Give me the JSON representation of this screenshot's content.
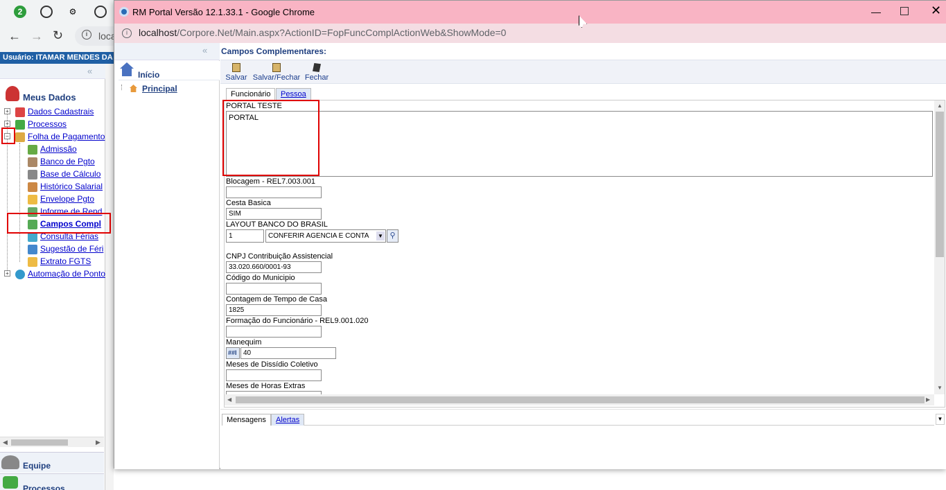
{
  "background_browser": {
    "badge": "2",
    "address_partial": "loca",
    "user_label": "Usuário: ITAMAR MENDES DA"
  },
  "bg_sidebar": {
    "section_title": "Meus Dados",
    "items": [
      {
        "label": "Dados Cadastrais",
        "icon": "person-icon"
      },
      {
        "label": "Processos",
        "icon": "processes-icon"
      },
      {
        "label": "Folha de Pagamento",
        "icon": "payroll-icon"
      },
      {
        "label": "Admissão",
        "icon": "person-icon"
      },
      {
        "label": "Banco de Pgto",
        "icon": "bank-icon"
      },
      {
        "label": "Base de Cálculo",
        "icon": "calc-icon"
      },
      {
        "label": "Histórico Salarial",
        "icon": "chart-icon"
      },
      {
        "label": "Envelope Pgto",
        "icon": "envelope-icon"
      },
      {
        "label": "Informe de Rend",
        "icon": "report-icon"
      },
      {
        "label": "Campos Compl",
        "icon": "fields-icon"
      },
      {
        "label": "Consulta Férias",
        "icon": "vacation-icon"
      },
      {
        "label": "Sugestão de Féri",
        "icon": "vacation-icon"
      },
      {
        "label": "Extrato FGTS",
        "icon": "statement-icon"
      },
      {
        "label": "Automação de Ponto",
        "icon": "clock-icon"
      }
    ],
    "footer_items": [
      "Equipe",
      "Processos"
    ]
  },
  "window": {
    "title": "RM Portal Versão 12.1.33.1 - Google Chrome",
    "url_host": "localhost",
    "url_path": "/Corpore.Net/Main.aspx?ActionID=FopFuncComplActionWeb&ShowMode=0"
  },
  "popup_left": {
    "home_label": "Início",
    "principal_label": "Principal"
  },
  "page": {
    "title": "Campos Complementares:",
    "toolbar": {
      "save": "Salvar",
      "save_close": "Salvar/Fechar",
      "close": "Fechar"
    },
    "tabs": {
      "funcionario": "Funcionário",
      "pessoa": "Pessoa"
    },
    "fields": {
      "portal_label": "PORTAL TESTE",
      "portal_value": "PORTAL",
      "blocagem_label": "Blocagem - REL7.003.001",
      "blocagem_value": "",
      "cesta_label": "Cesta Basica",
      "cesta_value": "SIM",
      "layout_label": "LAYOUT BANCO DO BRASIL",
      "layout_code": "1",
      "layout_select": "CONFERIR AGENCIA E CONTA",
      "cnpj_label": "CNPJ Contribuição Assistencial",
      "cnpj_value": "33.020.660/0001-93",
      "municipio_label": "Código do Municipio",
      "municipio_value": "",
      "contagem_label": "Contagem de Tempo de Casa",
      "contagem_value": "1825",
      "formacao_label": "Formação do Funcionário - REL9.001.020",
      "formacao_value": "",
      "manequim_label": "Manequim",
      "manequim_prefix": "##I",
      "manequim_value": "40",
      "dissidio_label": "Meses de Dissídio Coletivo",
      "dissidio_value": "",
      "horas_label": "Meses de Horas Extras"
    },
    "bottom_tabs": {
      "mensagens": "Mensagens",
      "alertas": "Alertas"
    }
  },
  "colors": {
    "title_bar": "#f9b4c4",
    "address_bar": "#f4dde3",
    "highlight": "#e00000",
    "header_blue": "#1f3f7f"
  }
}
